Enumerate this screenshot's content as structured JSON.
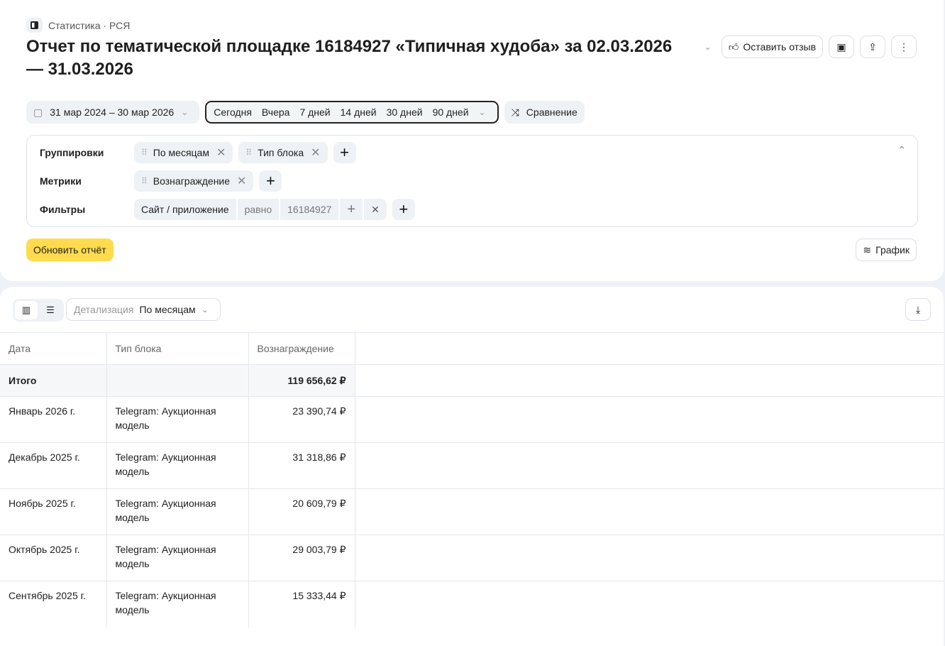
{
  "breadcrumb": "Статистика · РСЯ",
  "title": "Отчет по тематической площадке 16184927 «Типичная худоба» за 02.03.2026 — 31.03.2026",
  "actions": {
    "feedback": "Оставить отзыв"
  },
  "date_range": "31 мар 2024 – 30 мар 2026",
  "presets": [
    "Сегодня",
    "Вчера",
    "7 дней",
    "14 дней",
    "30 дней",
    "90 дней"
  ],
  "compare": "Сравнение",
  "groupings": {
    "label": "Группировки",
    "chips": [
      "По месяцам",
      "Тип блока"
    ]
  },
  "metrics": {
    "label": "Метрики",
    "chips": [
      "Вознаграждение"
    ]
  },
  "filters": {
    "label": "Фильтры",
    "field": "Сайт / приложение",
    "op": "равно",
    "value": "16184927"
  },
  "update": "Обновить отчёт",
  "graph": "График",
  "detail": {
    "label": "Детализация",
    "value": "По месяцам"
  },
  "table": {
    "headers": [
      "Дата",
      "Тип блока",
      "Вознаграждение"
    ],
    "total": {
      "label": "Итого",
      "value": "119 656,62 ₽"
    },
    "rows": [
      {
        "date": "Январь 2026 г.",
        "type": "Telegram: Аукционная модель",
        "value": "23 390,74 ₽"
      },
      {
        "date": "Декабрь 2025 г.",
        "type": "Telegram: Аукционная модель",
        "value": "31 318,86 ₽"
      },
      {
        "date": "Ноябрь 2025 г.",
        "type": "Telegram: Аукционная модель",
        "value": "20 609,79 ₽"
      },
      {
        "date": "Октябрь 2025 г.",
        "type": "Telegram: Аукционная модель",
        "value": "29 003,79 ₽"
      },
      {
        "date": "Сентябрь 2025 г.",
        "type": "Telegram: Аукционная модель",
        "value": "15 333,44 ₽"
      }
    ]
  }
}
